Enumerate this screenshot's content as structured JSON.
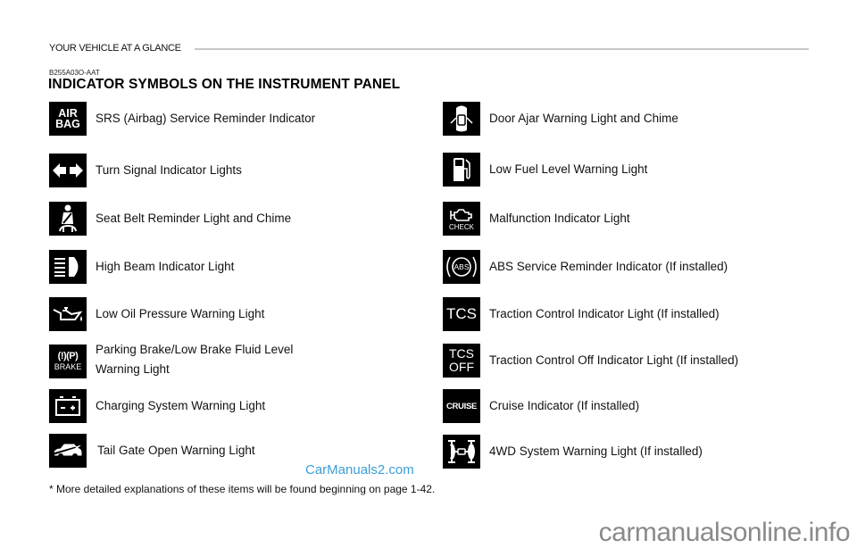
{
  "header": {
    "section": "YOUR VEHICLE AT A GLANCE",
    "code": "B255A03O-AAT",
    "title": "INDICATOR SYMBOLS ON THE INSTRUMENT PANEL"
  },
  "left_items": [
    {
      "icon": "airbag-icon",
      "icon_text": [
        "AIR",
        "BAG"
      ],
      "label": "SRS (Airbag) Service Reminder Indicator"
    },
    {
      "icon": "turn-signal-icon",
      "label": "Turn Signal Indicator Lights"
    },
    {
      "icon": "seat-belt-icon",
      "label": "Seat Belt Reminder Light and Chime"
    },
    {
      "icon": "high-beam-icon",
      "label": "High Beam Indicator Light"
    },
    {
      "icon": "oil-can-icon",
      "label": "Low Oil Pressure Warning Light"
    },
    {
      "icon": "brake-icon",
      "icon_text": [
        "(!)(P)",
        "BRAKE"
      ],
      "label_line1": "Parking Brake/Low Brake Fluid Level",
      "label_line2": "Warning Light"
    },
    {
      "icon": "battery-icon",
      "label": "Charging System Warning Light"
    },
    {
      "icon": "tail-gate-icon",
      "label": "Tail Gate Open Warning Light"
    }
  ],
  "right_items": [
    {
      "icon": "door-ajar-icon",
      "label": "Door Ajar Warning Light and Chime"
    },
    {
      "icon": "fuel-pump-icon",
      "label": "Low Fuel Level Warning Light"
    },
    {
      "icon": "check-engine-icon",
      "icon_text": [
        "CHECK"
      ],
      "label": "Malfunction Indicator Light"
    },
    {
      "icon": "abs-icon",
      "icon_text": [
        "ABS"
      ],
      "label": "ABS Service Reminder Indicator (If installed)"
    },
    {
      "icon": "tcs-icon",
      "icon_text": [
        "TCS"
      ],
      "label": "Traction Control Indicator Light (If installed)"
    },
    {
      "icon": "tcs-off-icon",
      "icon_text": [
        "TCS",
        "OFF"
      ],
      "label": "Traction Control Off Indicator Light (If installed)"
    },
    {
      "icon": "cruise-icon",
      "icon_text": [
        "CRUISE"
      ],
      "label": "Cruise Indicator (If installed)"
    },
    {
      "icon": "4wd-icon",
      "label": "4WD System Warning Light (If installed)"
    }
  ],
  "watermark": "CarManuals2.com",
  "footnote": "* More detailed explanations of these items will be found beginning on page 1-42.",
  "site": "carmanualsonline.info",
  "colors": {
    "icon_bg": "#000000",
    "watermark": "#3b9fd6",
    "rule": "#c8c8c8"
  }
}
